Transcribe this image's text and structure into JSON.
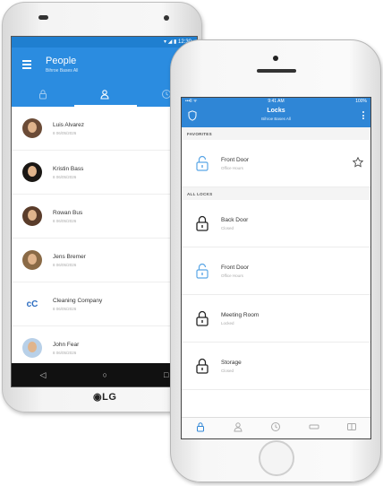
{
  "android": {
    "status_time": "12:30",
    "title": "People",
    "subtitle": "Bihroe Bases All",
    "tabs": [
      "locks-tab",
      "people-tab",
      "history-tab"
    ],
    "people": [
      {
        "name": "Luis Alvarez",
        "meta": "8  06/05/2026"
      },
      {
        "name": "Kristin Bass",
        "meta": "8  06/05/2026"
      },
      {
        "name": "Rowan Bus",
        "meta": "8  06/05/2026"
      },
      {
        "name": "Jens Bremer",
        "meta": "8  06/05/2026"
      },
      {
        "name": "Cleaning Company",
        "meta": "8  06/05/2026"
      },
      {
        "name": "John Fear",
        "meta": "8  06/05/2026"
      }
    ],
    "nav": {
      "back": "◁",
      "home": "○",
      "recent": "□"
    },
    "brand": "LG",
    "accent": "#2b8ce0"
  },
  "iphone": {
    "status": {
      "left": "•••ll ᯤ",
      "time": "9:41 AM",
      "right": "100%"
    },
    "title": "Locks",
    "subtitle": "Bihroe Bases All",
    "sections": {
      "favorites": "FAVORITES",
      "all_locks": "ALL LOCKS"
    },
    "favorite_locks": [
      {
        "name": "Front Door",
        "state": "Office Hours",
        "unlocked": true
      }
    ],
    "locks": [
      {
        "name": "Back Door",
        "state": "Closed",
        "unlocked": false
      },
      {
        "name": "Front Door",
        "state": "Office Hours",
        "unlocked": true
      },
      {
        "name": "Meeting Room",
        "state": "Locked",
        "unlocked": false
      },
      {
        "name": "Storage",
        "state": "Closed",
        "unlocked": false
      }
    ],
    "accent": "#2f86d6"
  }
}
